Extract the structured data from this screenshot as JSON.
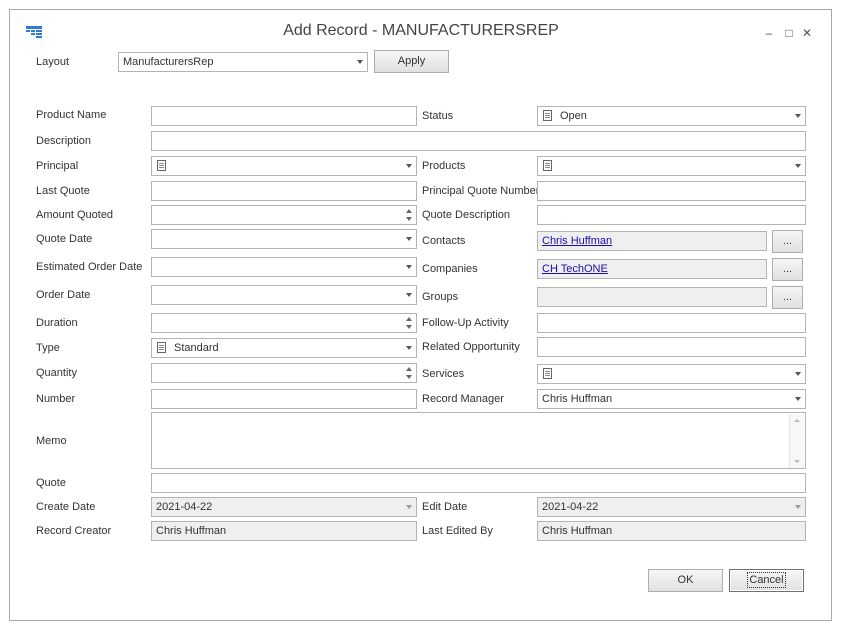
{
  "window": {
    "title": "Add Record - MANUFACTURERSREP",
    "minimize": "–",
    "maximize": "□",
    "close": "✕"
  },
  "layout": {
    "label": "Layout",
    "value": "ManufacturersRep",
    "apply_label": "Apply"
  },
  "fields": {
    "product_name": {
      "label": "Product Name",
      "value": ""
    },
    "status": {
      "label": "Status",
      "value": "Open"
    },
    "description": {
      "label": "Description",
      "value": ""
    },
    "principal": {
      "label": "Principal",
      "value": ""
    },
    "products": {
      "label": "Products",
      "value": ""
    },
    "last_quote": {
      "label": "Last Quote",
      "value": ""
    },
    "principal_quote_number": {
      "label": "Principal Quote Number",
      "value": ""
    },
    "amount_quoted": {
      "label": "Amount Quoted",
      "value": ""
    },
    "quote_description": {
      "label": "Quote Description",
      "value": ""
    },
    "quote_date": {
      "label": "Quote Date",
      "value": ""
    },
    "contacts": {
      "label": "Contacts",
      "value": "Chris Huffman"
    },
    "estimated_order_date": {
      "label": "Estimated Order Date",
      "value": ""
    },
    "companies": {
      "label": "Companies",
      "value": "CH TechONE"
    },
    "order_date": {
      "label": "Order Date",
      "value": ""
    },
    "groups": {
      "label": "Groups",
      "value": ""
    },
    "duration": {
      "label": "Duration",
      "value": ""
    },
    "follow_up_activity": {
      "label": "Follow-Up Activity",
      "value": ""
    },
    "type": {
      "label": "Type",
      "value": "Standard"
    },
    "related_opportunity": {
      "label": "Related Opportunity",
      "value": ""
    },
    "quantity": {
      "label": "Quantity",
      "value": ""
    },
    "services": {
      "label": "Services",
      "value": ""
    },
    "number": {
      "label": "Number",
      "value": ""
    },
    "record_manager": {
      "label": "Record Manager",
      "value": "Chris Huffman"
    },
    "memo": {
      "label": "Memo",
      "value": ""
    },
    "quote": {
      "label": "Quote",
      "value": ""
    },
    "create_date": {
      "label": "Create Date",
      "value": "2021-04-22"
    },
    "edit_date": {
      "label": "Edit Date",
      "value": "2021-04-22"
    },
    "record_creator": {
      "label": "Record Creator",
      "value": "Chris Huffman"
    },
    "last_edited_by": {
      "label": "Last Edited By",
      "value": "Chris Huffman"
    }
  },
  "ellipsis_label": "...",
  "footer": {
    "ok_label": "OK",
    "cancel_label": "Cancel"
  },
  "icons": {
    "app": "grid-table-icon",
    "record_type": "document-icon"
  },
  "colors": {
    "link": "#1a0dab",
    "readonly_bg": "#efefef",
    "border": "#b3b3b3",
    "app_icon": "#2e7bcf"
  }
}
